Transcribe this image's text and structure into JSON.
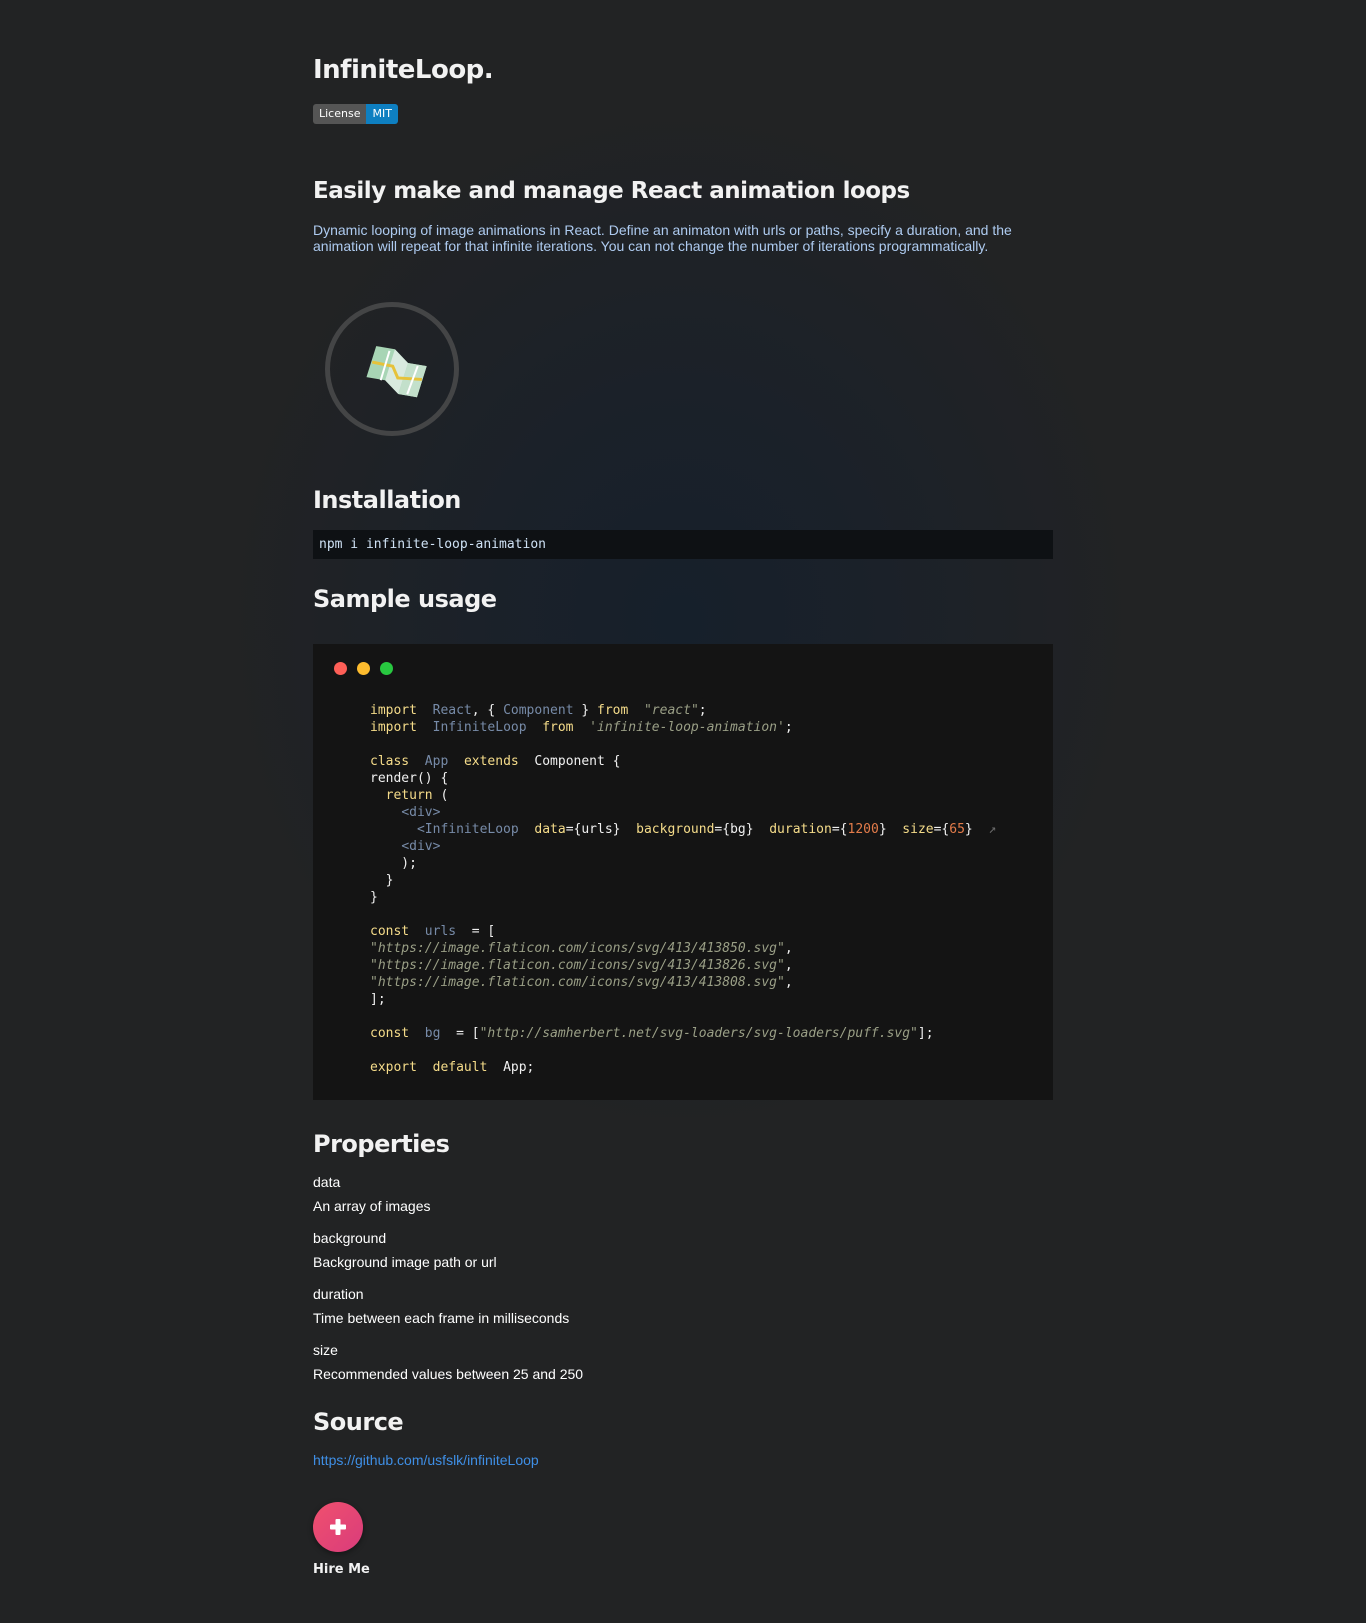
{
  "header": {
    "title": "InfiniteLoop.",
    "badge": {
      "label": "License",
      "value": "MIT"
    }
  },
  "intro": {
    "heading": "Easily make and manage React animation loops",
    "text": "Dynamic looping of image animations in React. Define an animaton with urls or paths, specify a duration, and the animation will repeat for that infinite iterations. You can not change the number of iterations programmatically.",
    "preview_icon": "map-icon"
  },
  "installation": {
    "heading": "Installation",
    "command": "npm i infinite-loop-animation"
  },
  "sample": {
    "heading": "Sample usage",
    "window_dots": [
      "#fe5f57",
      "#febc2e",
      "#28c840"
    ],
    "code": {
      "l1_kw": "import",
      "l1_react": "React",
      "l1_comp": "Component",
      "l1_from": "from",
      "l1_str": "\"react\"",
      "l2_kw": "import",
      "l2_il": "InfiniteLoop",
      "l2_from": "from",
      "l2_str": "'infinite-loop-animation'",
      "l4_class": "class",
      "l4_app": "App",
      "l4_extends": "extends",
      "l4_comp": "Component {",
      "l5": "render() {",
      "l6_return": "return",
      "l7": "<div>",
      "l8_tag": "<InfiniteLoop",
      "l8_data": "data",
      "l8_data_v": "={urls}",
      "l8_bg": "background",
      "l8_bg_v": "={bg}",
      "l8_dur": "duration",
      "l8_dur_n": "1200",
      "l8_size": "size",
      "l8_size_n": "65",
      "l8_close": "↗",
      "l9": "<div>",
      "l13_const": "const",
      "l13_var": "urls",
      "url1": "\"https://image.flaticon.com/icons/svg/413/413850.svg\"",
      "url2": "\"https://image.flaticon.com/icons/svg/413/413826.svg\"",
      "url3": "\"https://image.flaticon.com/icons/svg/413/413808.svg\"",
      "l19_const": "const",
      "l19_var": "bg",
      "l19_str": "\"http://samherbert.net/svg-loaders/svg-loaders/puff.svg\"",
      "l21_export": "export",
      "l21_default": "default",
      "l21_app": "App;"
    }
  },
  "properties": {
    "heading": "Properties",
    "items": [
      {
        "name": "data",
        "desc": "An array of images"
      },
      {
        "name": "background",
        "desc": "Background image path or url"
      },
      {
        "name": "duration",
        "desc": "Time between each frame in milliseconds"
      },
      {
        "name": "size",
        "desc": "Recommended values between 25 and 250"
      }
    ]
  },
  "source": {
    "heading": "Source",
    "link": "https://github.com/usfslk/infiniteLoop"
  },
  "hire": {
    "icon": "plus-icon",
    "label": "Hire Me"
  }
}
